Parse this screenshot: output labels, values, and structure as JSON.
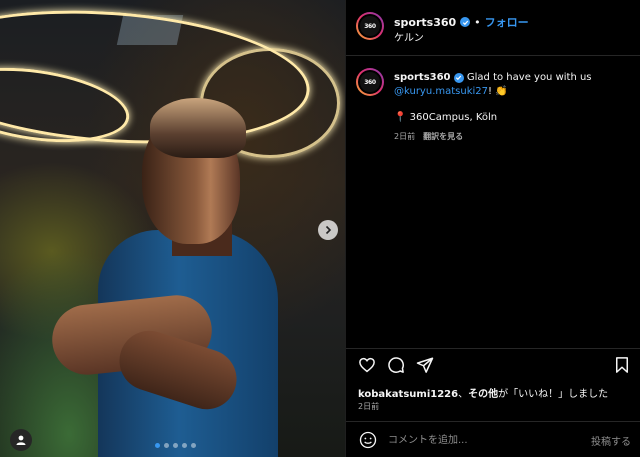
{
  "post": {
    "image_dots_total": 5,
    "image_dots_active": 0
  },
  "header": {
    "avatar_text": "360",
    "username": "sports360",
    "separator": "•",
    "follow_label": "フォロー",
    "location": "ケルン"
  },
  "caption": {
    "avatar_text": "360",
    "username": "sports360",
    "text": "Glad to have you with us",
    "mention": "@kuryu.matsuki27",
    "suffix": "! 👏",
    "location_pin": "📍",
    "location": "360Campus, Köln",
    "age": "2日前",
    "translate_label": "翻訳を見る"
  },
  "actions": {
    "like_icon": "heart-icon",
    "comment_icon": "comment-icon",
    "share_icon": "paper-plane-icon",
    "save_icon": "bookmark-icon"
  },
  "likes": {
    "user": "kobakatsumi1226",
    "connector": "、",
    "others": "その他",
    "suffix": "が「いいね！」しました",
    "date": "2日前"
  },
  "comment": {
    "placeholder": "コメントを追加...",
    "post_label": "投稿する"
  },
  "colors": {
    "accent": "#3897f0",
    "background": "#000000",
    "muted": "#a8a8a8"
  }
}
